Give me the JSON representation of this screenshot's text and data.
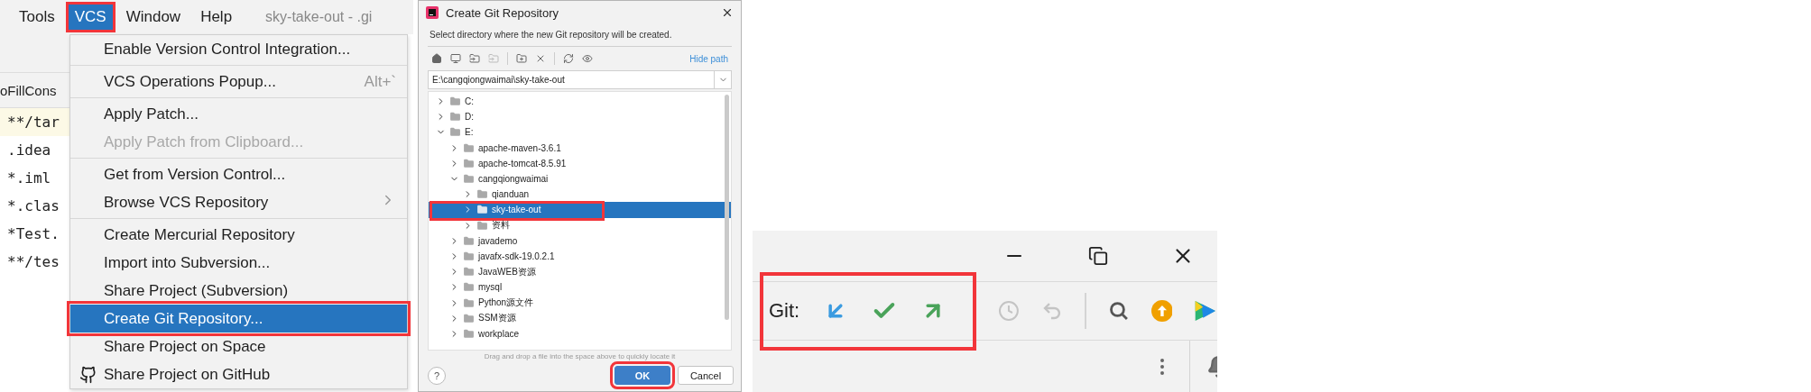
{
  "ide": {
    "menus": [
      {
        "label": "Tools",
        "selected": false,
        "highlighted": false
      },
      {
        "label": "VCS",
        "selected": true,
        "highlighted": true
      },
      {
        "label": "Window",
        "selected": false,
        "highlighted": false
      },
      {
        "label": "Help",
        "selected": false,
        "highlighted": false
      }
    ],
    "window_title": "sky-take-out - .gi",
    "editor_tab": "oFillCons",
    "editor_lines": [
      {
        "text": "**/tar",
        "current": true
      },
      {
        "text": ".idea",
        "current": false
      },
      {
        "text": "*.iml",
        "current": false
      },
      {
        "text": "*.clas",
        "current": false
      },
      {
        "text": "*Test.",
        "current": false
      },
      {
        "text": "**/tes",
        "current": false
      }
    ],
    "menu_groups": [
      {
        "items": [
          {
            "label": "Enable Version Control Integration...",
            "kind": "item",
            "disabled": false,
            "selected": false,
            "highlighted": false
          }
        ]
      },
      {
        "items": [
          {
            "label": "VCS Operations Popup...",
            "shortcut": "Alt+`",
            "kind": "item",
            "disabled": false,
            "selected": false,
            "highlighted": false
          }
        ]
      },
      {
        "items": [
          {
            "label": "Apply Patch...",
            "kind": "item",
            "disabled": false,
            "selected": false,
            "highlighted": false
          },
          {
            "label": "Apply Patch from Clipboard...",
            "kind": "item",
            "disabled": true,
            "selected": false,
            "highlighted": false
          }
        ]
      },
      {
        "items": [
          {
            "label": "Get from Version Control...",
            "kind": "item",
            "disabled": false,
            "selected": false,
            "highlighted": false
          },
          {
            "label": "Browse VCS Repository",
            "kind": "submenu",
            "disabled": false,
            "selected": false,
            "highlighted": false
          }
        ]
      },
      {
        "items": [
          {
            "label": "Create Mercurial Repository",
            "kind": "item",
            "disabled": false,
            "selected": false,
            "highlighted": false
          },
          {
            "label": "Import into Subversion...",
            "kind": "item",
            "disabled": false,
            "selected": false,
            "highlighted": false
          },
          {
            "label": "Share Project (Subversion)",
            "kind": "item",
            "disabled": false,
            "selected": false,
            "highlighted": false
          },
          {
            "label": "Create Git Repository...",
            "kind": "item",
            "disabled": false,
            "selected": true,
            "highlighted": true
          },
          {
            "label": "Share Project on Space",
            "kind": "item",
            "disabled": false,
            "selected": false,
            "highlighted": false
          },
          {
            "label": "Share Project on GitHub",
            "kind": "github",
            "disabled": false,
            "selected": false,
            "highlighted": false
          }
        ]
      }
    ]
  },
  "dialog": {
    "title": "Create Git Repository",
    "description": "Select directory where the new Git repository will be created.",
    "hide_path": "Hide path",
    "path": "E:\\cangqiongwaimai\\sky-take-out",
    "tree": [
      {
        "label": "C:",
        "expanded": false,
        "selected": false,
        "highlighted": false
      },
      {
        "label": "D:",
        "expanded": false,
        "selected": false,
        "highlighted": false
      },
      {
        "label": "E:",
        "expanded": true,
        "selected": false,
        "highlighted": false,
        "children": [
          {
            "label": "apache-maven-3.6.1",
            "expanded": false,
            "selected": false,
            "highlighted": false
          },
          {
            "label": "apache-tomcat-8.5.91",
            "expanded": false,
            "selected": false,
            "highlighted": false
          },
          {
            "label": "cangqiongwaimai",
            "expanded": true,
            "selected": false,
            "highlighted": false,
            "children": [
              {
                "label": "qianduan",
                "expanded": false,
                "selected": false,
                "highlighted": false
              },
              {
                "label": "sky-take-out",
                "expanded": false,
                "selected": true,
                "highlighted": true
              },
              {
                "label": "资料",
                "expanded": false,
                "selected": false,
                "highlighted": false
              }
            ]
          },
          {
            "label": "javademo",
            "expanded": false,
            "selected": false,
            "highlighted": false
          },
          {
            "label": "javafx-sdk-19.0.2.1",
            "expanded": false,
            "selected": false,
            "highlighted": false
          },
          {
            "label": "JavaWEB资源",
            "expanded": false,
            "selected": false,
            "highlighted": false
          },
          {
            "label": "mysql",
            "expanded": false,
            "selected": false,
            "highlighted": false
          },
          {
            "label": "Python源文件",
            "expanded": false,
            "selected": false,
            "highlighted": false
          },
          {
            "label": "SSM资源",
            "expanded": false,
            "selected": false,
            "highlighted": false
          },
          {
            "label": "workplace",
            "expanded": false,
            "selected": false,
            "highlighted": false
          }
        ]
      }
    ],
    "hint": "Drag and drop a file into the space above to quickly locate it",
    "help": "?",
    "buttons": [
      {
        "label": "OK",
        "kind": "primary",
        "highlighted": true
      },
      {
        "label": "Cancel",
        "kind": "secondary",
        "highlighted": false
      }
    ]
  },
  "git_toolbar": {
    "label": "Git:",
    "highlighted": true,
    "git_tools": [
      {
        "kind": "update",
        "disabled": false
      },
      {
        "kind": "commit",
        "disabled": false
      },
      {
        "kind": "push",
        "disabled": false
      }
    ],
    "tools": [
      {
        "kind": "history",
        "disabled": true
      },
      {
        "kind": "rollback",
        "disabled": true
      },
      {
        "kind": "separator"
      },
      {
        "kind": "search",
        "disabled": false
      },
      {
        "kind": "upgrade",
        "disabled": false
      },
      {
        "kind": "logo",
        "disabled": false
      }
    ]
  }
}
